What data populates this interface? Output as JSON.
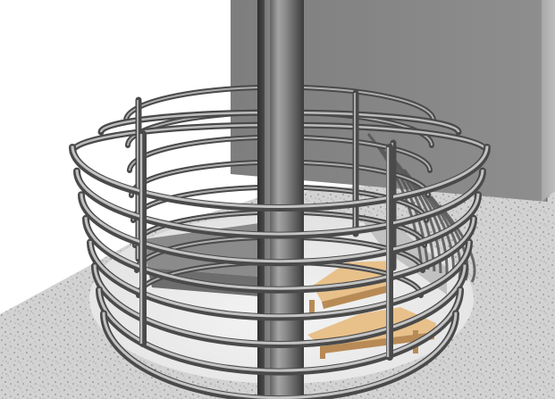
{
  "scene": {
    "kind": "3d-render",
    "subject": "spiral-staircase",
    "colors": {
      "background": "#ffffff",
      "floor": "#d2d2d2",
      "floor_speckle": "#7a7a7a",
      "wall": "#8a8a8a",
      "wall_edge": "#6a6a6a",
      "column_mid": "#8c8c8c",
      "column_dark": "#3a3a3a",
      "rail_light": "#d8d8d8",
      "rail_dark": "#4a4a4a",
      "tread_top": "#e8c08a",
      "tread_side": "#b88a55",
      "stringer": "#6e6e6e"
    },
    "counts": {
      "horizontal_rails": 8,
      "visible_treads": 2
    }
  }
}
